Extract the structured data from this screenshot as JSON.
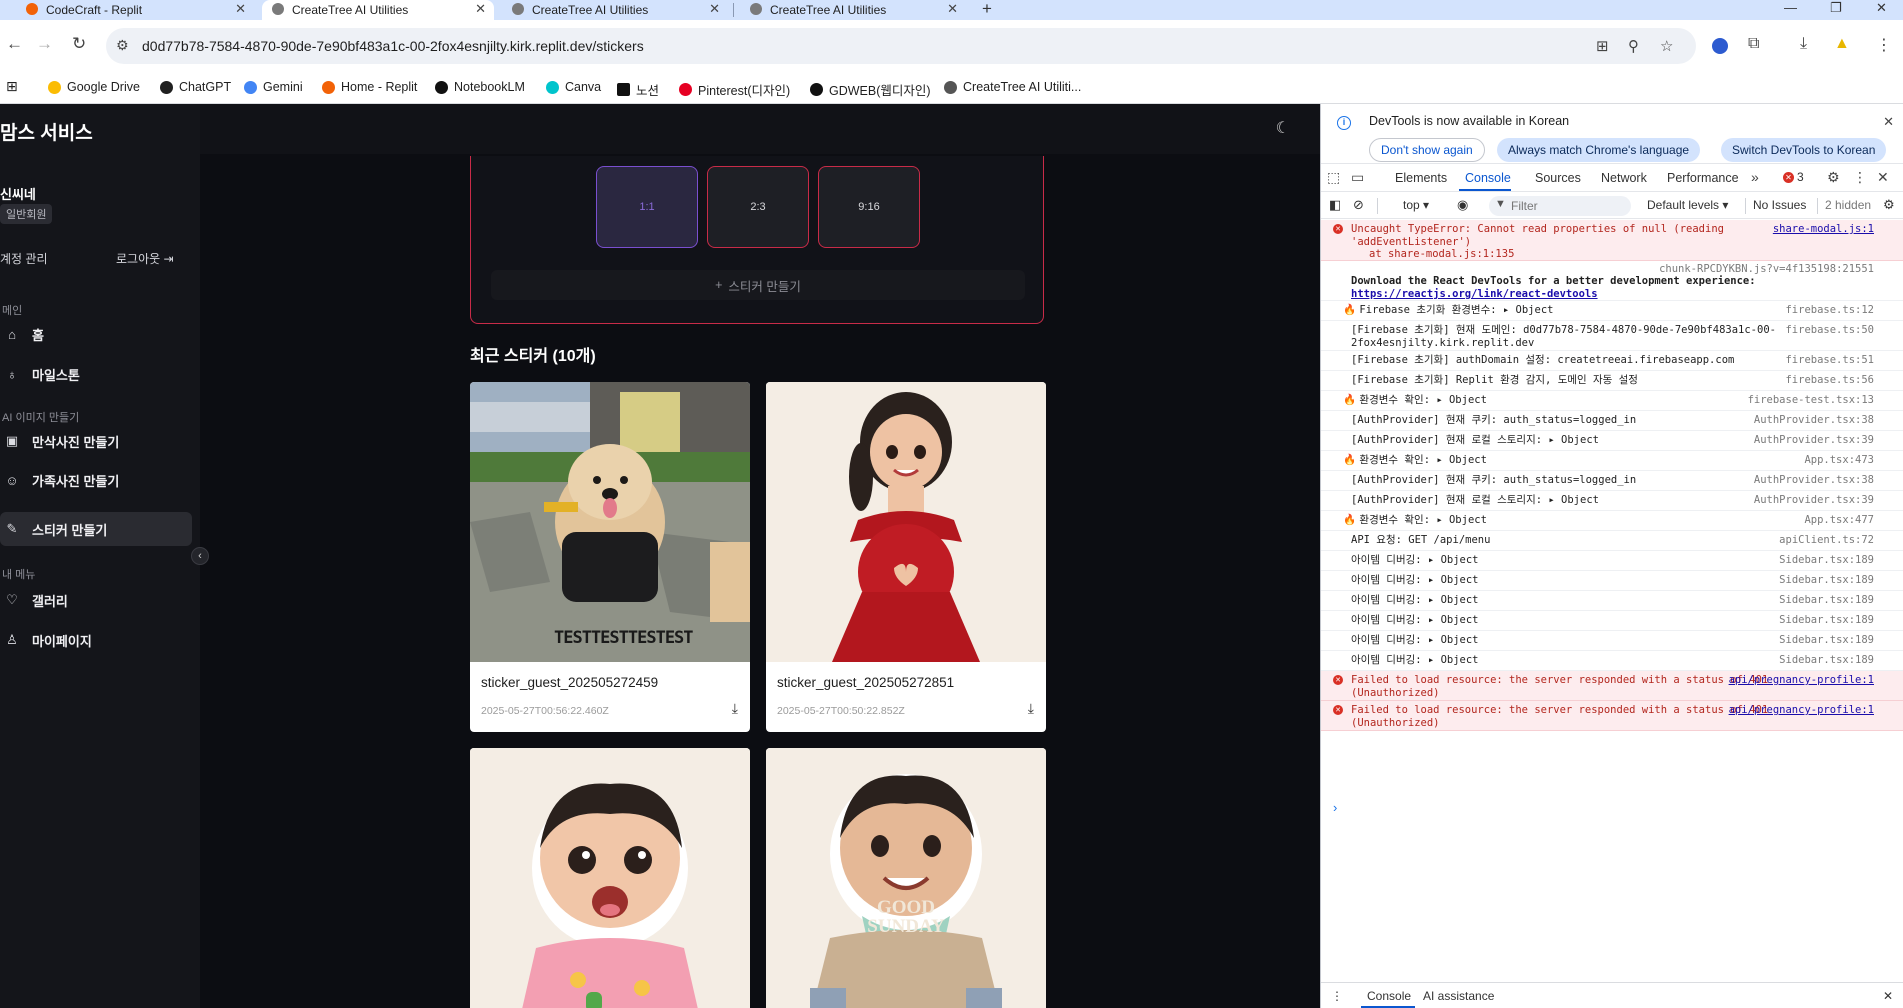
{
  "browser": {
    "tabs": [
      {
        "title": "CodeCraft - Replit"
      },
      {
        "title": "CreateTree AI Utilities"
      },
      {
        "title": "CreateTree AI Utilities"
      },
      {
        "title": "CreateTree AI Utilities"
      }
    ],
    "url": "d0d77b78-7584-4870-90de-7e90bf483a1c-00-2fox4esnjilty.kirk.replit.dev/stickers",
    "bookmarks": [
      {
        "label": "Google Drive",
        "color": "#fbbc04"
      },
      {
        "label": "ChatGPT",
        "color": "#202020"
      },
      {
        "label": "Gemini",
        "color": "#4285f4"
      },
      {
        "label": "Home - Replit",
        "color": "#f26207"
      },
      {
        "label": "NotebookLM",
        "color": "#111111"
      },
      {
        "label": "Canva",
        "color": "#00c4cc"
      },
      {
        "label": "노션",
        "color": "#111111"
      },
      {
        "label": "Pinterest(디자인)",
        "color": "#e60023"
      },
      {
        "label": "GDWEB(웹디자인)",
        "color": "#111111"
      },
      {
        "label": "CreateTree AI Utiliti...",
        "color": "#555555"
      }
    ]
  },
  "app": {
    "brand": "맘스 서비스",
    "user": {
      "name": "신씨네",
      "badge": "일반회원"
    },
    "account_label": "계정 관리",
    "logout_label": "로그아웃",
    "sections": {
      "main": "메인",
      "ai": "AI 이미지 만들기",
      "my": "내 메뉴"
    },
    "nav": [
      {
        "label": "홈",
        "icon": "home-icon"
      },
      {
        "label": "마일스톤",
        "icon": "award-icon"
      },
      {
        "label": "만삭사진 만들기",
        "icon": "image-plus-icon"
      },
      {
        "label": "가족사진 만들기",
        "icon": "users-icon"
      },
      {
        "label": "스티커 만들기",
        "icon": "sticker-icon"
      },
      {
        "label": "갤러리",
        "icon": "heart-icon"
      },
      {
        "label": "마이페이지",
        "icon": "user-icon"
      }
    ],
    "aspect_ratios": [
      "1:1",
      "2:3",
      "9:16"
    ],
    "selected_ratio": "1:1",
    "make_sticker_label": "스티커 만들기",
    "recent_title": "최근 스티커 (10개)",
    "stickers": [
      {
        "name": "sticker_guest_202505272459",
        "date": "2025-05-27T00:56:22.460Z",
        "image_text": "TESTTESTTESTEST"
      },
      {
        "name": "sticker_guest_202505272851",
        "date": "2025-05-27T00:50:22.852Z"
      },
      {
        "name": "",
        "date": ""
      },
      {
        "name": "",
        "date": "",
        "image_text_line1": "GOOD",
        "image_text_line2": "SUNDAY"
      }
    ],
    "accent_color": "#c82b48",
    "selected_color": "#7a4fd0"
  },
  "devtools": {
    "notice": "DevTools is now available in Korean",
    "buttons": [
      "Don't show again",
      "Always match Chrome's language",
      "Switch DevTools to Korean"
    ],
    "tabs": [
      "Elements",
      "Console",
      "Sources",
      "Network",
      "Performance"
    ],
    "error_count": "3",
    "context": "top",
    "filter_placeholder": "Filter",
    "levels": "Default levels",
    "issues": "No Issues",
    "hidden": "2 hidden",
    "logs": [
      {
        "type": "error",
        "msg": "Uncaught TypeError: Cannot read properties of null (reading 'addEventListener')",
        "msg2": "at share-modal.js:1:135",
        "src": "share-modal.js:1"
      },
      {
        "type": "info",
        "msg": "Download the React DevTools for a better development experience:",
        "link": "https://reactjs.org/link/react-devtools",
        "src": "chunk-RPCDYKBN.js?v=4f135198:21551"
      },
      {
        "type": "log",
        "fire": true,
        "msg": "Firebase 초기화 환경변수: ▸ Object",
        "src": "firebase.ts:12"
      },
      {
        "type": "log",
        "msg": "[Firebase 초기화] 현재 도메인: d0d77b78-7584-4870-90de-7e90bf483a1c-00-2fox4esnjilty.kirk.replit.dev",
        "src": "firebase.ts:50"
      },
      {
        "type": "log",
        "msg": "[Firebase 초기화] authDomain 설정: createtreeai.firebaseapp.com",
        "src": "firebase.ts:51"
      },
      {
        "type": "log",
        "msg": "[Firebase 초기화] Replit 환경 감지, 도메인 자동 설정",
        "src": "firebase.ts:56"
      },
      {
        "type": "log",
        "fire": true,
        "msg": "환경변수 확인: ▸ Object",
        "src": "firebase-test.tsx:13"
      },
      {
        "type": "log",
        "msg": "[AuthProvider] 현재 쿠키: auth_status=logged_in",
        "src": "AuthProvider.tsx:38"
      },
      {
        "type": "log",
        "msg": "[AuthProvider] 현재 로컬 스토리지: ▸ Object",
        "src": "AuthProvider.tsx:39"
      },
      {
        "type": "log",
        "fire": true,
        "msg": "환경변수 확인: ▸ Object",
        "src": "App.tsx:473"
      },
      {
        "type": "log",
        "msg": "[AuthProvider] 현재 쿠키: auth_status=logged_in",
        "src": "AuthProvider.tsx:38"
      },
      {
        "type": "log",
        "msg": "[AuthProvider] 현재 로컬 스토리지: ▸ Object",
        "src": "AuthProvider.tsx:39"
      },
      {
        "type": "log",
        "fire": true,
        "msg": "환경변수 확인: ▸ Object",
        "src": "App.tsx:477"
      },
      {
        "type": "log",
        "msg": "API 요청: GET /api/menu",
        "src": "apiClient.ts:72"
      },
      {
        "type": "log",
        "msg": "아이템 디버깅: ▸ Object",
        "src": "Sidebar.tsx:189"
      },
      {
        "type": "log",
        "msg": "아이템 디버깅: ▸ Object",
        "src": "Sidebar.tsx:189"
      },
      {
        "type": "log",
        "msg": "아이템 디버깅: ▸ Object",
        "src": "Sidebar.tsx:189"
      },
      {
        "type": "log",
        "msg": "아이템 디버깅: ▸ Object",
        "src": "Sidebar.tsx:189"
      },
      {
        "type": "log",
        "msg": "아이템 디버깅: ▸ Object",
        "src": "Sidebar.tsx:189"
      },
      {
        "type": "log",
        "msg": "아이템 디버깅: ▸ Object",
        "src": "Sidebar.tsx:189"
      },
      {
        "type": "error",
        "msg": "Failed to load resource: the server responded with a status of 401 (Unauthorized)",
        "src": "api/pregnancy-profile:1"
      },
      {
        "type": "error",
        "msg": "Failed to load resource: the server responded with a status of 401 (Unauthorized)",
        "src": "api/pregnancy-profile:1"
      }
    ],
    "drawer_tabs": [
      "Console",
      "AI assistance"
    ]
  }
}
